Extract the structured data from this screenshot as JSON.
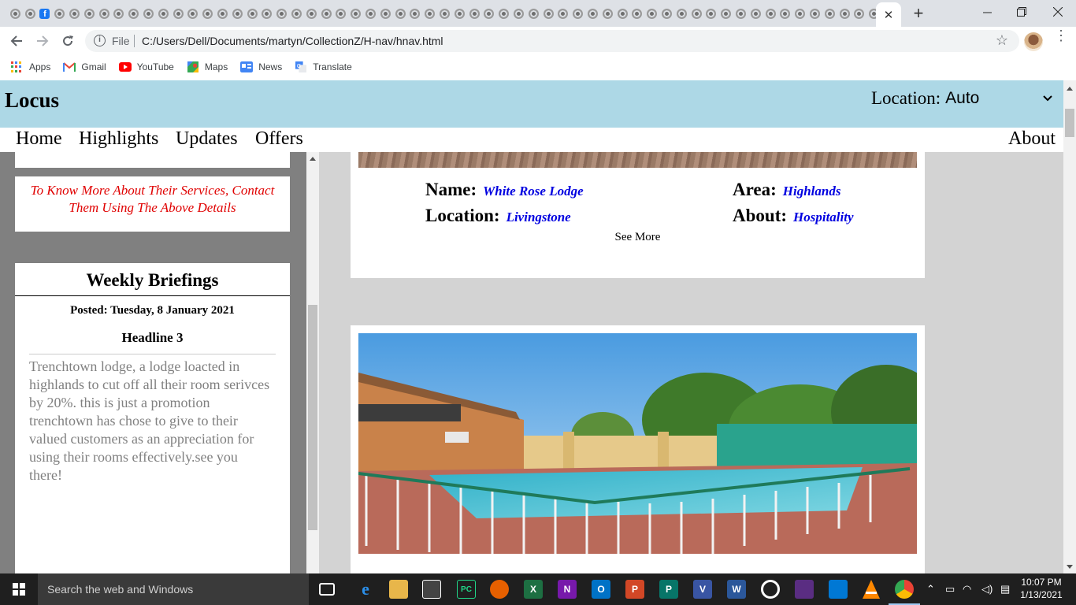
{
  "browser": {
    "url": "C:/Users/Dell/Documents/martyn/CollectionZ/H-nav/hnav.html",
    "scheme_label": "File",
    "bookmarks": [
      {
        "label": "Apps",
        "icon": "apps-grid-icon"
      },
      {
        "label": "Gmail",
        "icon": "gmail-icon"
      },
      {
        "label": "YouTube",
        "icon": "youtube-icon"
      },
      {
        "label": "Maps",
        "icon": "maps-icon"
      },
      {
        "label": "News",
        "icon": "news-icon"
      },
      {
        "label": "Translate",
        "icon": "translate-icon"
      }
    ],
    "close_tab_glyph": "✕",
    "new_tab_glyph": "+"
  },
  "site": {
    "brand": "Locus",
    "location_label": "Location:",
    "location_value": "Auto",
    "nav": [
      "Home",
      "Highlights",
      "Updates",
      "Offers"
    ],
    "nav_right": "About",
    "header_color": "#add8e6"
  },
  "sidebar": {
    "contact_text": "To Know More About Their Services, Contact Them Using The Above Details",
    "briefing": {
      "title": "Weekly Briefings",
      "posted": "Posted: Tuesday, 8 January 2021",
      "headline": "Headline 3",
      "body": "Trenchtown lodge, a lodge loacted in highlands to cut off all their room serivces by 20%. this is just a promotion trenchtown has chose to give to their valued customers as an appreciation for using their rooms effectively.see you there!"
    }
  },
  "listing": {
    "name_label": "Name:",
    "name_value": "White Rose Lodge",
    "area_label": "Area:",
    "area_value": "Highlands",
    "location_label": "Location:",
    "location_value": "Livingstone",
    "about_label": "About:",
    "about_value": "Hospitality",
    "see_more": "See More"
  },
  "taskbar": {
    "search_placeholder": "Search the web and Windows",
    "time": "10:07 PM",
    "date": "1/13/2021"
  }
}
